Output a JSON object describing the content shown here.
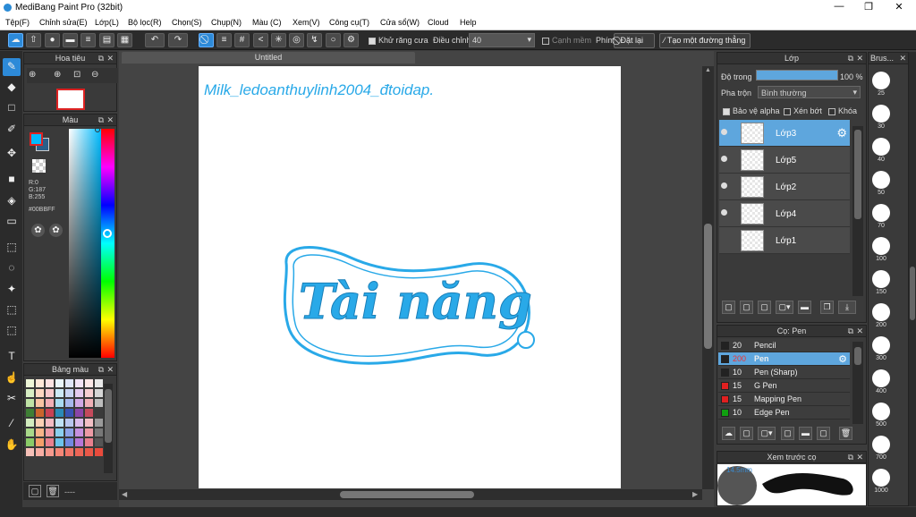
{
  "window": {
    "title": "MediBang Paint Pro (32bit)",
    "controls": [
      "—",
      "❐",
      "✕"
    ]
  },
  "menu": [
    "Tệp(F)",
    "Chỉnh sửa(E)",
    "Lớp(L)",
    "Bộ lọc(R)",
    "Chọn(S)",
    "Chụp(N)",
    "Màu (C)",
    "Xem(V)",
    "Công cụ(T)",
    "Cửa sổ(W)",
    "Cloud",
    "Help"
  ],
  "toolbar": {
    "antialias_label": "Khử răng cưa",
    "adjust_label": "Điều chỉnh",
    "adjust_value": "40",
    "soft_edge_label": "Cạnh mềm",
    "key_label": "Phím",
    "reset_label": "Đặt lại",
    "line_label": "Tạo một đường thẳng"
  },
  "navigator": {
    "title": "Hoa tiêu"
  },
  "color_panel": {
    "title": "Màu",
    "r": "R:0",
    "g": "G:187",
    "b": "B:255",
    "hex": "#00BBFF",
    "fg_color": "#00bbff",
    "bg_color": "#2a5f8a"
  },
  "palette_panel": {
    "title": "Bảng màu",
    "footer": "----"
  },
  "document": {
    "tab": "Untitled",
    "signature": "Milk_ledoanthuylinh2004_đtoidap.",
    "artwork_text": "Tài năng"
  },
  "layer_panel": {
    "title": "Lớp",
    "opacity_label": "Độ trong",
    "opacity_value": "100 %",
    "blend_label": "Pha trộn",
    "blend_value": "Bình thường",
    "protect_alpha": "Bảo vệ alpha",
    "clipping": "Xén bớt",
    "lock": "Khóa",
    "layers": [
      {
        "name": "Lớp3",
        "selected": true
      },
      {
        "name": "Lớp5",
        "selected": false
      },
      {
        "name": "Lớp2",
        "selected": false
      },
      {
        "name": "Lớp4",
        "selected": false
      },
      {
        "name": "Lớp1",
        "selected": false
      }
    ]
  },
  "brush_panel": {
    "title": "Cọ: Pen",
    "brushes": [
      {
        "size": "20",
        "name": "Pencil",
        "color": "#222222",
        "selected": false
      },
      {
        "size": "200",
        "name": "Pen",
        "color": "#222222",
        "selected": true
      },
      {
        "size": "10",
        "name": "Pen (Sharp)",
        "color": "#222222",
        "selected": false
      },
      {
        "size": "15",
        "name": "G Pen",
        "color": "#e02020",
        "selected": false
      },
      {
        "size": "15",
        "name": "Mapping Pen",
        "color": "#e02020",
        "selected": false
      },
      {
        "size": "10",
        "name": "Edge Pen",
        "color": "#10a010",
        "selected": false
      }
    ]
  },
  "brush_size_panel": {
    "title": "Brus...",
    "sizes": [
      "25",
      "30",
      "40",
      "50",
      "70",
      "100",
      "150",
      "200",
      "300",
      "400",
      "500",
      "700",
      "1000"
    ]
  },
  "preview_panel": {
    "title": "Xem trước cọ",
    "size_label": "14.5mm"
  }
}
